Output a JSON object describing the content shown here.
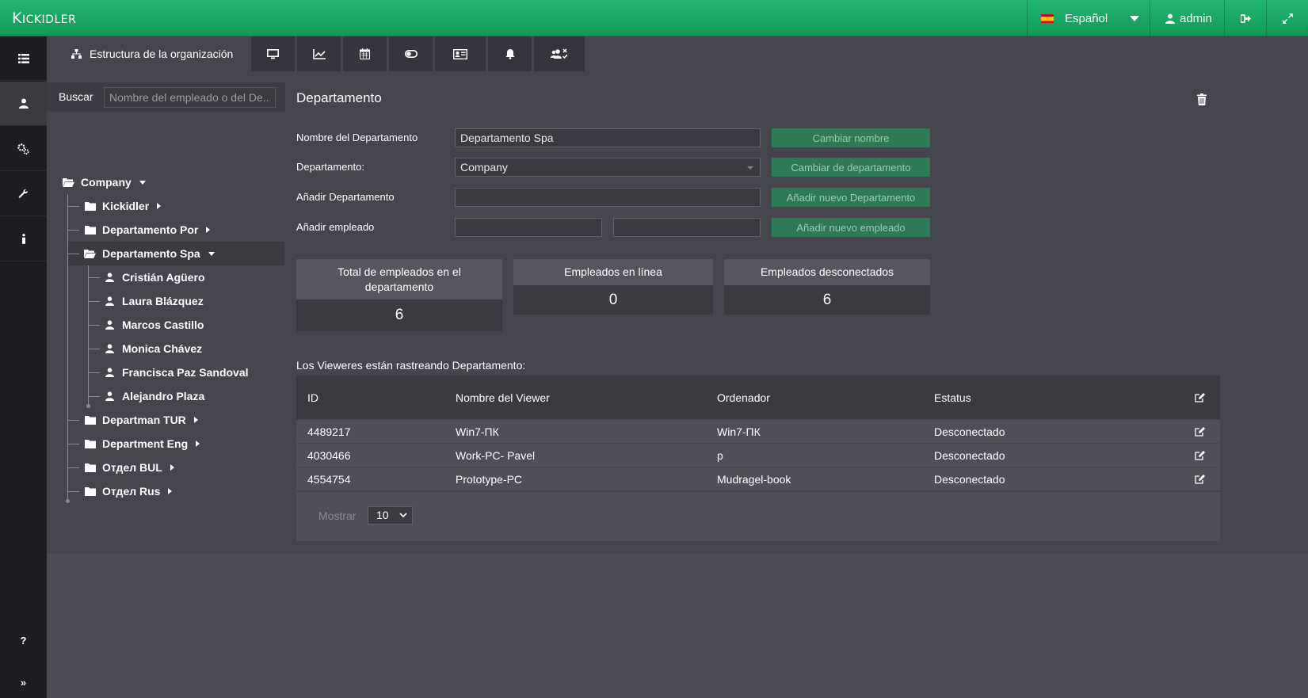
{
  "app": {
    "logo_text": "KICKIDLER",
    "language": "Español",
    "user": "admin",
    "accent_color": "#1fad69"
  },
  "tabs": {
    "active_label": "Estructura de la organización",
    "icons": [
      "monitor-icon",
      "chart-line-icon",
      "calendar-icon",
      "toggle-icon",
      "id-card-icon",
      "bell-icon",
      "users-x-icon"
    ]
  },
  "sidebar": {
    "items": [
      "list-icon",
      "user-icon",
      "gears-icon",
      "wrench-icon",
      "info-icon"
    ],
    "help": "?",
    "expand": "»"
  },
  "search": {
    "label": "Buscar",
    "placeholder": "Nombre del empleado o del De..."
  },
  "tree": {
    "root": "Company",
    "departments": {
      "kickidler": "Kickidler",
      "por": "Departamento Por",
      "spa": "Departamento Spa",
      "tur": "Departman TUR",
      "eng": "Department Eng",
      "bul": "Отдел BUL",
      "rus": "Отдел Rus"
    },
    "employees": [
      "Cristián Agüero",
      "Laura Blázquez",
      "Marcos Castillo",
      "Monica Chávez",
      "Francisca Paz Sandoval",
      "Alejandro Plaza"
    ]
  },
  "form": {
    "title": "Departamento",
    "name_label": "Nombre del Departamento",
    "name_value": "Departamento Spa",
    "rename_button": "Cambiar nombre",
    "parent_label": "Departamento:",
    "parent_value": "Company",
    "change_parent_button": "Cambiar de departamento",
    "add_dept_label": "Añadir Departamento",
    "add_dept_value": "",
    "add_dept_button": "Añadir nuevo Departamento",
    "add_emp_label": "Añadir empleado",
    "add_emp_first": "",
    "add_emp_last": "",
    "add_emp_button": "Añadir nuevo empleado"
  },
  "stats": {
    "total_label": "Total de empleados en el departamento",
    "total_value": "6",
    "online_label": "Empleados en línea",
    "online_value": "0",
    "offline_label": "Empleados desconectados",
    "offline_value": "6"
  },
  "table": {
    "caption": "Los Vieweres están rastreando Departamento:",
    "headers": {
      "id": "ID",
      "name": "Nombre del Viewer",
      "computer": "Ordenador",
      "status": "Estatus"
    },
    "rows": [
      {
        "id": "4489217",
        "name": "Win7-ПК",
        "computer": "Win7-ПК",
        "status": "Desconectado"
      },
      {
        "id": "4030466",
        "name": "Work-PC- Pavel",
        "computer": "p",
        "status": "Desconectado"
      },
      {
        "id": "4554754",
        "name": "Prototype-PC",
        "computer": "Mudragel-book",
        "status": "Desconectado"
      }
    ],
    "show_label": "Mostrar",
    "page_size": "10"
  }
}
